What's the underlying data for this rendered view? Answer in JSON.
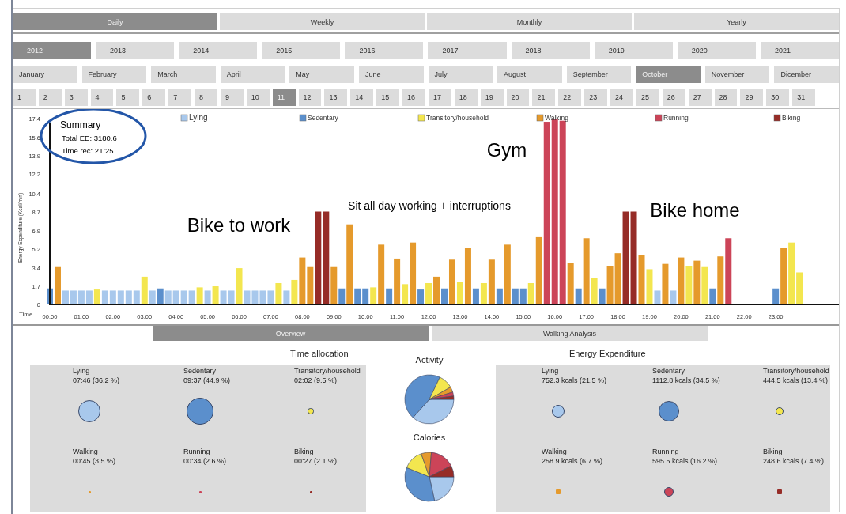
{
  "period_tabs": [
    {
      "label": "Daily",
      "selected": true
    },
    {
      "label": "Weekly",
      "selected": false
    },
    {
      "label": "Monthly",
      "selected": false
    },
    {
      "label": "Yearly",
      "selected": false
    }
  ],
  "years": [
    {
      "label": "2012",
      "selected": true
    },
    {
      "label": "2013",
      "selected": false
    },
    {
      "label": "2014",
      "selected": false
    },
    {
      "label": "2015",
      "selected": false
    },
    {
      "label": "2016",
      "selected": false
    },
    {
      "label": "2017",
      "selected": false
    },
    {
      "label": "2018",
      "selected": false
    },
    {
      "label": "2019",
      "selected": false
    },
    {
      "label": "2020",
      "selected": false
    },
    {
      "label": "2021",
      "selected": false
    }
  ],
  "months": [
    {
      "label": "January",
      "selected": false
    },
    {
      "label": "February",
      "selected": false
    },
    {
      "label": "March",
      "selected": false
    },
    {
      "label": "April",
      "selected": false
    },
    {
      "label": "May",
      "selected": false
    },
    {
      "label": "June",
      "selected": false
    },
    {
      "label": "July",
      "selected": false
    },
    {
      "label": "August",
      "selected": false
    },
    {
      "label": "September",
      "selected": false
    },
    {
      "label": "October",
      "selected": true
    },
    {
      "label": "November",
      "selected": false
    },
    {
      "label": "Dicember",
      "selected": false
    }
  ],
  "days": [
    {
      "label": "1",
      "selected": false
    },
    {
      "label": "2",
      "selected": false
    },
    {
      "label": "3",
      "selected": false
    },
    {
      "label": "4",
      "selected": false
    },
    {
      "label": "5",
      "selected": false
    },
    {
      "label": "6",
      "selected": false
    },
    {
      "label": "7",
      "selected": false
    },
    {
      "label": "8",
      "selected": false
    },
    {
      "label": "9",
      "selected": false
    },
    {
      "label": "10",
      "selected": false
    },
    {
      "label": "11",
      "selected": true
    },
    {
      "label": "12",
      "selected": false
    },
    {
      "label": "13",
      "selected": false
    },
    {
      "label": "14",
      "selected": false
    },
    {
      "label": "15",
      "selected": false
    },
    {
      "label": "16",
      "selected": false
    },
    {
      "label": "17",
      "selected": false
    },
    {
      "label": "18",
      "selected": false
    },
    {
      "label": "19",
      "selected": false
    },
    {
      "label": "20",
      "selected": false
    },
    {
      "label": "21",
      "selected": false
    },
    {
      "label": "22",
      "selected": false
    },
    {
      "label": "23",
      "selected": false
    },
    {
      "label": "24",
      "selected": false
    },
    {
      "label": "25",
      "selected": false
    },
    {
      "label": "26",
      "selected": false
    },
    {
      "label": "27",
      "selected": false
    },
    {
      "label": "28",
      "selected": false
    },
    {
      "label": "29",
      "selected": false
    },
    {
      "label": "30",
      "selected": false
    },
    {
      "label": "31",
      "selected": false
    }
  ],
  "summary": {
    "title": "Summary",
    "total": "Total EE: 3180.6",
    "time": "Time rec: 21:25"
  },
  "energy_chart": {
    "chart_data": {
      "type": "bar",
      "xlabel": "Time",
      "ylabel": "Energy Expenditure (Kcal/min)",
      "x": [
        0,
        0.25,
        0.5,
        0.75,
        1,
        1.25,
        1.5,
        1.75,
        2,
        2.25,
        2.5,
        2.75,
        3,
        3.25,
        3.5,
        3.75,
        4,
        4.25,
        4.5,
        4.75,
        5,
        5.25,
        5.5,
        5.75,
        6,
        6.25,
        6.5,
        6.75,
        7,
        7.25,
        7.5,
        7.75,
        8,
        8.25,
        8.5,
        8.75,
        9,
        9.25,
        9.5,
        9.75,
        10,
        10.25,
        10.5,
        10.75,
        11,
        11.25,
        11.5,
        11.75,
        12,
        12.25,
        12.5,
        12.75,
        13,
        13.25,
        13.5,
        13.75,
        14,
        14.25,
        14.5,
        14.75,
        15,
        15.25,
        15.5,
        15.75,
        16,
        16.25,
        16.5,
        16.75,
        17,
        17.25,
        17.5,
        17.75,
        18,
        18.25,
        18.5,
        18.75,
        19,
        19.25,
        19.5,
        19.75,
        20,
        20.25,
        20.5,
        20.75,
        21,
        21.25,
        21.5,
        21.75,
        22,
        22.25,
        22.5,
        22.75,
        23,
        23.25,
        23.5,
        23.75
      ],
      "series": [
        {
          "name": "Lying",
          "color": "#a8c8ec",
          "values": [
            null,
            null,
            1.3,
            1.3,
            1.3,
            1.3,
            null,
            1.3,
            1.3,
            1.3,
            1.3,
            1.3,
            null,
            1.3,
            null,
            1.3,
            1.3,
            1.3,
            1.3,
            null,
            1.3,
            null,
            1.3,
            1.3,
            null,
            1.3,
            1.3,
            1.3,
            1.3,
            null,
            1.3,
            null,
            null,
            null,
            null,
            null,
            null,
            null,
            null,
            null,
            null,
            null,
            null,
            null,
            null,
            null,
            null,
            null,
            null,
            null,
            null,
            null,
            null,
            null,
            null,
            null,
            null,
            null,
            null,
            null,
            null,
            null,
            null,
            null,
            null,
            null,
            null,
            null,
            null,
            null,
            null,
            null,
            null,
            null,
            null,
            null,
            null,
            1.3,
            null,
            1.3,
            null,
            null,
            null,
            null,
            null,
            null,
            null,
            null,
            null,
            null,
            null,
            null,
            null,
            null,
            null,
            null
          ]
        },
        {
          "name": "Sedentary",
          "color": "#5b8fcc",
          "values": [
            1.5,
            null,
            null,
            null,
            null,
            null,
            null,
            null,
            null,
            null,
            null,
            null,
            null,
            null,
            1.5,
            null,
            null,
            null,
            null,
            null,
            null,
            null,
            null,
            null,
            null,
            null,
            null,
            null,
            null,
            null,
            null,
            null,
            null,
            null,
            null,
            null,
            null,
            1.5,
            null,
            1.5,
            1.5,
            null,
            null,
            1.5,
            null,
            null,
            null,
            1.4,
            null,
            null,
            1.5,
            null,
            null,
            null,
            1.5,
            null,
            null,
            1.5,
            null,
            1.5,
            1.5,
            null,
            null,
            null,
            null,
            null,
            null,
            1.5,
            null,
            null,
            1.5,
            null,
            null,
            null,
            null,
            null,
            null,
            null,
            null,
            null,
            null,
            null,
            null,
            null,
            1.5,
            null,
            null,
            null,
            null,
            null,
            null,
            null,
            1.5,
            null,
            null,
            null
          ]
        },
        {
          "name": "Transitory/household",
          "color": "#f3e64f",
          "values": [
            null,
            null,
            null,
            null,
            null,
            null,
            1.4,
            null,
            null,
            null,
            null,
            null,
            2.6,
            null,
            null,
            null,
            null,
            null,
            null,
            1.6,
            null,
            1.7,
            null,
            null,
            3.4,
            null,
            null,
            null,
            null,
            2.0,
            null,
            2.3,
            null,
            null,
            null,
            null,
            null,
            null,
            null,
            null,
            null,
            1.6,
            null,
            null,
            null,
            1.9,
            null,
            null,
            2.0,
            null,
            null,
            null,
            2.1,
            null,
            null,
            2.0,
            null,
            null,
            null,
            null,
            null,
            2.0,
            null,
            null,
            null,
            null,
            null,
            null,
            null,
            2.5,
            null,
            null,
            null,
            null,
            null,
            null,
            3.3,
            null,
            null,
            null,
            null,
            3.6,
            null,
            3.5,
            null,
            null,
            null,
            null,
            null,
            null,
            null,
            null,
            null,
            null,
            5.8,
            3.0
          ]
        },
        {
          "name": "Walking",
          "color": "#e59a2c",
          "values": [
            null,
            3.5,
            null,
            null,
            null,
            null,
            null,
            null,
            null,
            null,
            null,
            null,
            null,
            null,
            null,
            null,
            null,
            null,
            null,
            null,
            null,
            null,
            null,
            null,
            null,
            null,
            null,
            null,
            null,
            null,
            null,
            null,
            4.4,
            3.5,
            null,
            null,
            3.5,
            null,
            7.5,
            null,
            null,
            null,
            5.6,
            null,
            4.3,
            null,
            5.8,
            null,
            null,
            2.6,
            null,
            4.2,
            null,
            5.3,
            null,
            null,
            4.2,
            null,
            5.6,
            null,
            null,
            null,
            6.3,
            null,
            null,
            null,
            3.9,
            null,
            6.2,
            null,
            null,
            3.6,
            4.8,
            null,
            null,
            4.6,
            null,
            null,
            3.8,
            null,
            4.4,
            null,
            4.1,
            null,
            null,
            4.5,
            null,
            null,
            null,
            null,
            null,
            null,
            null,
            5.3,
            null,
            null
          ]
        },
        {
          "name": "Running",
          "color": "#cc4458",
          "values": [
            null,
            null,
            null,
            null,
            null,
            null,
            null,
            null,
            null,
            null,
            null,
            null,
            null,
            null,
            null,
            null,
            null,
            null,
            null,
            null,
            null,
            null,
            null,
            null,
            null,
            null,
            null,
            null,
            null,
            null,
            null,
            null,
            null,
            null,
            null,
            null,
            null,
            null,
            null,
            null,
            null,
            null,
            null,
            null,
            null,
            null,
            null,
            null,
            null,
            null,
            null,
            null,
            null,
            null,
            null,
            null,
            null,
            null,
            null,
            null,
            null,
            null,
            null,
            17.1,
            17.4,
            17.2,
            null,
            null,
            null,
            null,
            null,
            null,
            null,
            null,
            null,
            null,
            null,
            null,
            null,
            null,
            null,
            null,
            null,
            null,
            null,
            null,
            6.2,
            null,
            null,
            null,
            null,
            null,
            null,
            null,
            null,
            null
          ]
        },
        {
          "name": "Biking",
          "color": "#962c27",
          "values": [
            null,
            null,
            null,
            null,
            null,
            null,
            null,
            null,
            null,
            null,
            null,
            null,
            null,
            null,
            null,
            null,
            null,
            null,
            null,
            null,
            null,
            null,
            null,
            null,
            null,
            null,
            null,
            null,
            null,
            null,
            null,
            null,
            null,
            null,
            8.7,
            8.7,
            null,
            null,
            null,
            null,
            null,
            null,
            null,
            null,
            null,
            null,
            null,
            null,
            null,
            null,
            null,
            null,
            null,
            null,
            null,
            null,
            null,
            null,
            null,
            null,
            null,
            null,
            null,
            null,
            null,
            null,
            null,
            null,
            null,
            null,
            null,
            null,
            null,
            8.7,
            8.7,
            null,
            null,
            null,
            null,
            null,
            null,
            null,
            null,
            null,
            null,
            null,
            null,
            null,
            null,
            null,
            null,
            null,
            null,
            null,
            null,
            null
          ]
        }
      ],
      "ylim": [
        0,
        17.4
      ],
      "yticks": [
        0,
        1.7,
        3.4,
        5.2,
        6.9,
        8.7,
        10.4,
        12.2,
        13.9,
        15.6,
        17.4
      ],
      "xticks": [
        {
          "value": 0,
          "label": "00:00"
        },
        {
          "value": 1,
          "label": "01:00"
        },
        {
          "value": 2,
          "label": "02:00"
        },
        {
          "value": 3,
          "label": "03:00"
        },
        {
          "value": 4,
          "label": "04:00"
        },
        {
          "value": 5,
          "label": "05:00"
        },
        {
          "value": 6,
          "label": "06:00"
        },
        {
          "value": 7,
          "label": "07:00"
        },
        {
          "value": 8,
          "label": "08:00"
        },
        {
          "value": 9,
          "label": "09:00"
        },
        {
          "value": 10,
          "label": "10:00"
        },
        {
          "value": 11,
          "label": "11:00"
        },
        {
          "value": 12,
          "label": "12:00"
        },
        {
          "value": 13,
          "label": "13:00"
        },
        {
          "value": 14,
          "label": "14:00"
        },
        {
          "value": 15,
          "label": "15:00"
        },
        {
          "value": 16,
          "label": "16:00"
        },
        {
          "value": 17,
          "label": "17:00"
        },
        {
          "value": 18,
          "label": "18:00"
        },
        {
          "value": 19,
          "label": "19:00"
        },
        {
          "value": 20,
          "label": "20:00"
        },
        {
          "value": 21,
          "label": "21:00"
        },
        {
          "value": 22,
          "label": "22:00"
        },
        {
          "value": 23,
          "label": "23:00"
        }
      ],
      "xlim": [
        0,
        25
      ],
      "legend": "top",
      "annotations": [
        "Bike to work",
        "Sit all day working + interruptions",
        "Gym",
        "Bike home"
      ]
    }
  },
  "analysis_tabs": [
    {
      "label": "Overview",
      "selected": true
    },
    {
      "label": "Walking Analysis",
      "selected": false
    }
  ],
  "time_allocation": {
    "title": "Time allocation",
    "items": [
      {
        "name": "Lying",
        "value": "07:46 (36.2 %)",
        "level": 0.362,
        "color": "#a8c8ec"
      },
      {
        "name": "Sedentary",
        "value": "09:37 (44.9 %)",
        "level": 0.449,
        "color": "#5b8fcc"
      },
      {
        "name": "Transitory/household",
        "value": "02:02 (9.5 %)",
        "level": 0.095,
        "color": "#f3e64f"
      },
      {
        "name": "Walking",
        "value": "00:45 (3.5 %)",
        "level": 0.035,
        "color": "#e59a2c"
      },
      {
        "name": "Running",
        "value": "00:34 (2.6 %)",
        "level": 0.026,
        "color": "#cc4458"
      },
      {
        "name": "Biking",
        "value": "00:27 (2.1 %)",
        "level": 0.021,
        "color": "#962c27"
      }
    ]
  },
  "pies": [
    {
      "title": "Activity"
    },
    {
      "title": "Calories"
    }
  ],
  "energy_expenditure": {
    "title": "Energy Expenditure",
    "items": [
      {
        "name": "Lying",
        "value": "752.3 kcals (21.5 %)",
        "level": 0.215,
        "color": "#a8c8ec"
      },
      {
        "name": "Sedentary",
        "value": "1112.8 kcals (34.5 %)",
        "level": 0.345,
        "color": "#5b8fcc"
      },
      {
        "name": "Transitory/household",
        "value": "444.5 kcals (13.4 %)",
        "level": 0.134,
        "color": "#f3e64f"
      },
      {
        "name": "Walking",
        "value": "258.9 kcals (6.7 %)",
        "level": 0.067,
        "color": "#e59a2c"
      },
      {
        "name": "Running",
        "value": "595.5 kcals (16.2 %)",
        "level": 0.162,
        "color": "#cc4458"
      },
      {
        "name": "Biking",
        "value": "248.6 kcals (7.4 %)",
        "level": 0.074,
        "color": "#962c27"
      }
    ]
  }
}
